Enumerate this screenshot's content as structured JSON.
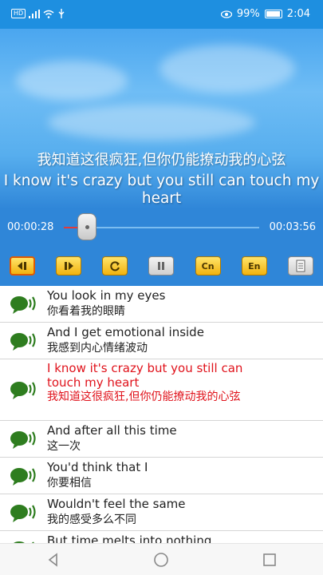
{
  "status": {
    "left_icons": [
      "hd-icon",
      "4g-signal-icon",
      "wifi-icon",
      "usb-icon"
    ],
    "hd_label": "HD",
    "battery": "99%",
    "time": "2:04"
  },
  "player": {
    "subtitle_cn": "我知道这很疯狂,但你仍能撩动我的心弦",
    "subtitle_en": "I know it's crazy but you still can touch my heart",
    "current_time": "00:00:28",
    "total_time": "00:03:56",
    "progress": 0.12
  },
  "toolbar": {
    "buttons": [
      {
        "icon": "previous-icon"
      },
      {
        "icon": "next-icon"
      },
      {
        "icon": "repeat-icon"
      },
      {
        "icon": "pause-icon"
      },
      {
        "label": "Cn"
      },
      {
        "label": "En"
      },
      {
        "icon": "document-icon"
      }
    ]
  },
  "lyrics": [
    {
      "en": "You look in my eyes",
      "cn": "你看着我的眼睛"
    },
    {
      "en": "And I get emotional inside",
      "cn": "我感到内心情绪波动"
    },
    {
      "en": "I know it's crazy but you still can touch my heart",
      "cn": "我知道这很疯狂,但你仍能撩动我的心弦"
    },
    {
      "en": "And after all this time",
      "cn": "这一次"
    },
    {
      "en": "You'd think that I",
      "cn": "你要相信"
    },
    {
      "en": "Wouldn't feel the same",
      "cn": "我的感受多么不同"
    },
    {
      "en": "But time melts into nothing",
      "cn": ""
    }
  ],
  "colors": {
    "status_bg": "#1e8fe0",
    "player_bg": "#2f86d8",
    "active_lyric": "#e0121b",
    "speaker_icon": "#2e7d1f"
  }
}
